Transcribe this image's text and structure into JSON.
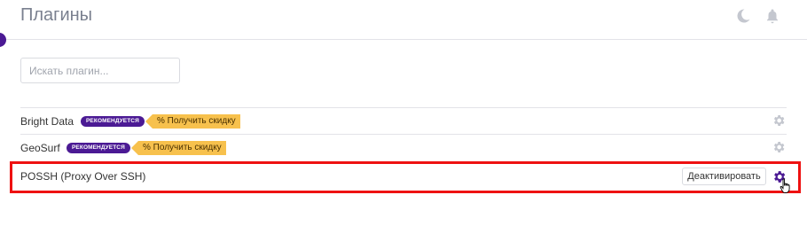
{
  "header": {
    "title": "Плагины",
    "icons": [
      "moon-icon",
      "bell-icon"
    ]
  },
  "search": {
    "placeholder": "Искать плагин..."
  },
  "plugins": [
    {
      "name": "Bright Data",
      "recommended_badge": "РЕКОМЕНДУЕТСЯ",
      "discount_badge": "% Получить скидку",
      "icon": "gear-icon"
    },
    {
      "name": "GeoSurf",
      "recommended_badge": "РЕКОМЕНДУЕТСЯ",
      "discount_badge": "% Получить скидку",
      "icon": "gear-icon"
    },
    {
      "name": "POSSH (Proxy Over SSH)",
      "action_label": "Деактивировать",
      "icon": "gear-icon",
      "highlighted": true
    }
  ],
  "colors": {
    "accent": "#4b1a94",
    "discount": "#f7c14d",
    "highlight_border": "#ee1111",
    "muted_icon": "#c4c7cf"
  }
}
